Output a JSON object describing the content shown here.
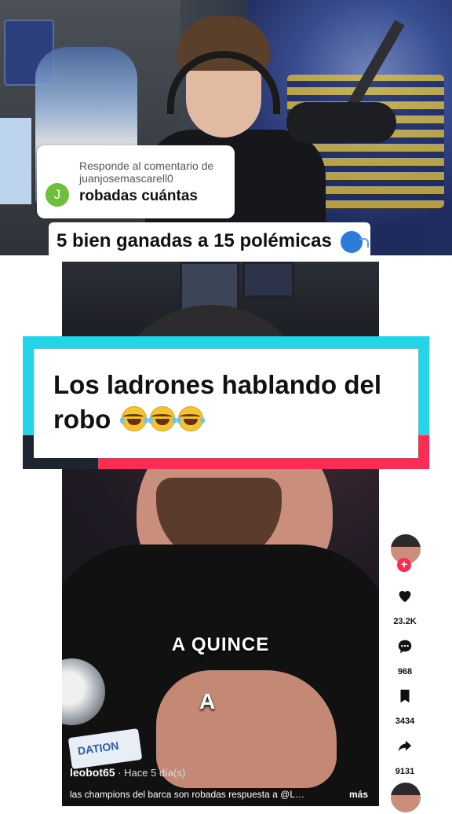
{
  "reply": {
    "label": "Responde al comentario de juanjosemascarell0",
    "avatar_letter": "J",
    "comment": "robadas cuántas"
  },
  "question": {
    "text": "5 bien ganadas a 15 polémicas",
    "icon": "speaking-head-icon"
  },
  "banner": {
    "text": "Los ladrones hablando del robo",
    "emoji_icon": "laughing-tears-icon",
    "colors": {
      "cyan": "#25d4e6",
      "pink": "#fe2c55",
      "dark": "#1e2430"
    }
  },
  "video": {
    "caption_line1": "A QUINCE",
    "caption_line2": "A",
    "sticker_text": "DATION",
    "username": "leobot65",
    "separator": " · ",
    "time": "Hace 5 día(s)",
    "description": "las champions del barca son robadas respuesta a @LACOBRAA...",
    "more_label": "más"
  },
  "rail": {
    "likes": "23.2K",
    "comments": "968",
    "saves": "3434",
    "shares": "9131",
    "plus": "+"
  }
}
